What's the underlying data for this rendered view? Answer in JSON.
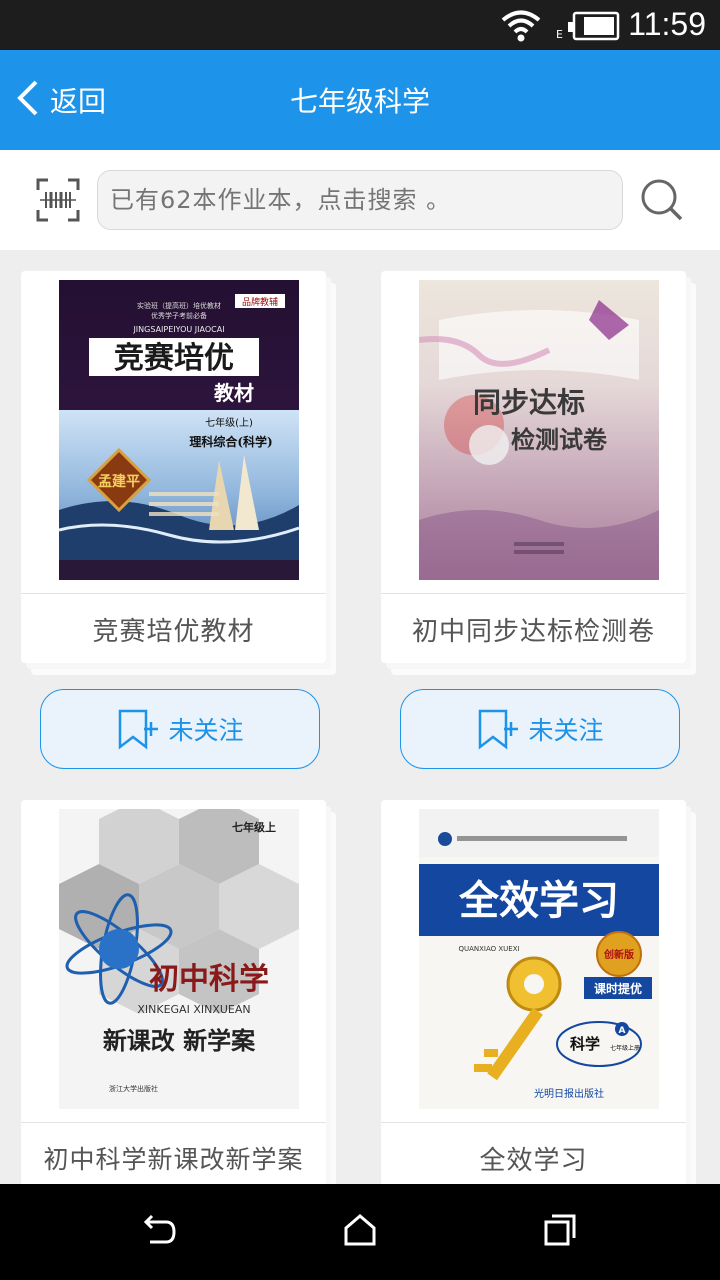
{
  "status_bar": {
    "time": "11:59"
  },
  "header": {
    "back_label": "返回",
    "title": "七年级科学"
  },
  "search": {
    "placeholder": "已有62本作业本，点击搜索 。"
  },
  "books": [
    {
      "title": "竞赛培优教材",
      "follow_label": "未关注",
      "cover": {
        "brand": "品牌教辅",
        "top_lines": [
          "实验班（提高班）培优教材",
          "优秀学子考前必备"
        ],
        "pinyin": "JINGSAIPEIYOU JIAOCAI",
        "main": "竞赛培优",
        "sub": "教材",
        "grade": "七年级(上)",
        "subject": "理科综合(科学)",
        "author": "孟建平"
      }
    },
    {
      "title": "初中同步达标检测卷",
      "follow_label": "未关注",
      "cover": {
        "line1": "同步达标",
        "line2": "检测试卷"
      }
    },
    {
      "title": "初中科学新课改新学案",
      "follow_label": "",
      "cover": {
        "grade": "七年级上",
        "main": "初中科学",
        "pinyin": "XINKEGAI XINXUEAN",
        "sub": "新课改 新学案",
        "publisher": "浙江大学出版社"
      }
    },
    {
      "title": "全效学习",
      "follow_label": "",
      "cover": {
        "main": "全效学习",
        "pinyin": "QUANXIAO XUEXI",
        "badge": "创新版",
        "tag": "课时提优",
        "subject": "科学",
        "grade": "七年级上册",
        "edition": "A",
        "publisher": "光明日报出版社"
      }
    }
  ],
  "colors": {
    "accent": "#1d93ea",
    "status_bar": "#1d1d1d",
    "nav_bar": "#000000"
  }
}
